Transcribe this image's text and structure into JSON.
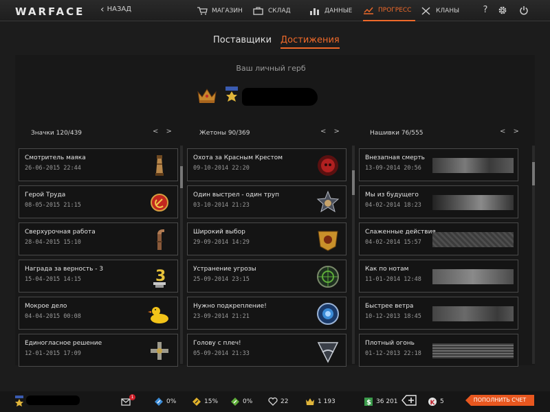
{
  "brand": "WARFACE",
  "nav": {
    "back": "НАЗАД",
    "items": [
      {
        "label": "МАГАЗИН",
        "icon": "cart-icon"
      },
      {
        "label": "СКЛАД",
        "icon": "briefcase-icon"
      },
      {
        "label": "ДАННЫЕ",
        "icon": "bar-chart-icon"
      },
      {
        "label": "ПРОГРЕСС",
        "icon": "progress-icon",
        "active": true
      },
      {
        "label": "КЛАНЫ",
        "icon": "crossed-swords-icon"
      }
    ],
    "help": "?",
    "accent": "#f06a2a"
  },
  "subtabs": [
    {
      "label": "Поставщики",
      "active": false
    },
    {
      "label": "Достижения",
      "active": true
    }
  ],
  "emblem": {
    "title": "Ваш личный герб"
  },
  "columns": [
    {
      "header": "Значки 120/439",
      "arrows": "< >",
      "items": [
        {
          "title": "Смотритель маяка",
          "date": "26-06-2015 22:44"
        },
        {
          "title": "Герой Труда",
          "date": "08-05-2015 21:15"
        },
        {
          "title": "Сверхурочная работа",
          "date": "28-04-2015 15:10"
        },
        {
          "title": "Награда за верность - 3",
          "date": "15-04-2015 14:15"
        },
        {
          "title": "Мокрое дело",
          "date": "04-04-2015 00:08"
        },
        {
          "title": "Единогласное решение",
          "date": "12-01-2015 17:09"
        }
      ]
    },
    {
      "header": "Жетоны 90/369",
      "arrows": "< >",
      "items": [
        {
          "title": "Охота за Красным Крестом",
          "date": "09-10-2014 22:20"
        },
        {
          "title": "Один выстрел - один труп",
          "date": "03-10-2014 21:23"
        },
        {
          "title": "Широкий выбор",
          "date": "29-09-2014 14:29"
        },
        {
          "title": "Устранение угрозы",
          "date": "25-09-2014 23:15"
        },
        {
          "title": "Нужно подкрепление!",
          "date": "23-09-2014 21:21"
        },
        {
          "title": "Голову с плеч!",
          "date": "05-09-2014 21:33"
        }
      ]
    },
    {
      "header": "Нашивки 76/555",
      "arrows": "< >",
      "items": [
        {
          "title": "Внезапная смерть",
          "date": "13-09-2014 20:56"
        },
        {
          "title": "Мы из будущего",
          "date": "04-02-2014 18:23"
        },
        {
          "title": "Слаженные действия",
          "date": "04-02-2014 15:57"
        },
        {
          "title": "Как по нотам",
          "date": "11-01-2014 12:48"
        },
        {
          "title": "Быстрее ветра",
          "date": "10-12-2013 18:45"
        },
        {
          "title": "Плотный огонь",
          "date": "01-12-2013 22:18"
        }
      ]
    }
  ],
  "bottom": {
    "mail_badge": "1",
    "boost1": "0%",
    "boost2": "15%",
    "boost3": "0%",
    "hearts": "22",
    "crowns": "1 193",
    "money": "36 201",
    "kredits": "5",
    "topup": "ПОПОЛНИТЬ СЧЕТ"
  }
}
